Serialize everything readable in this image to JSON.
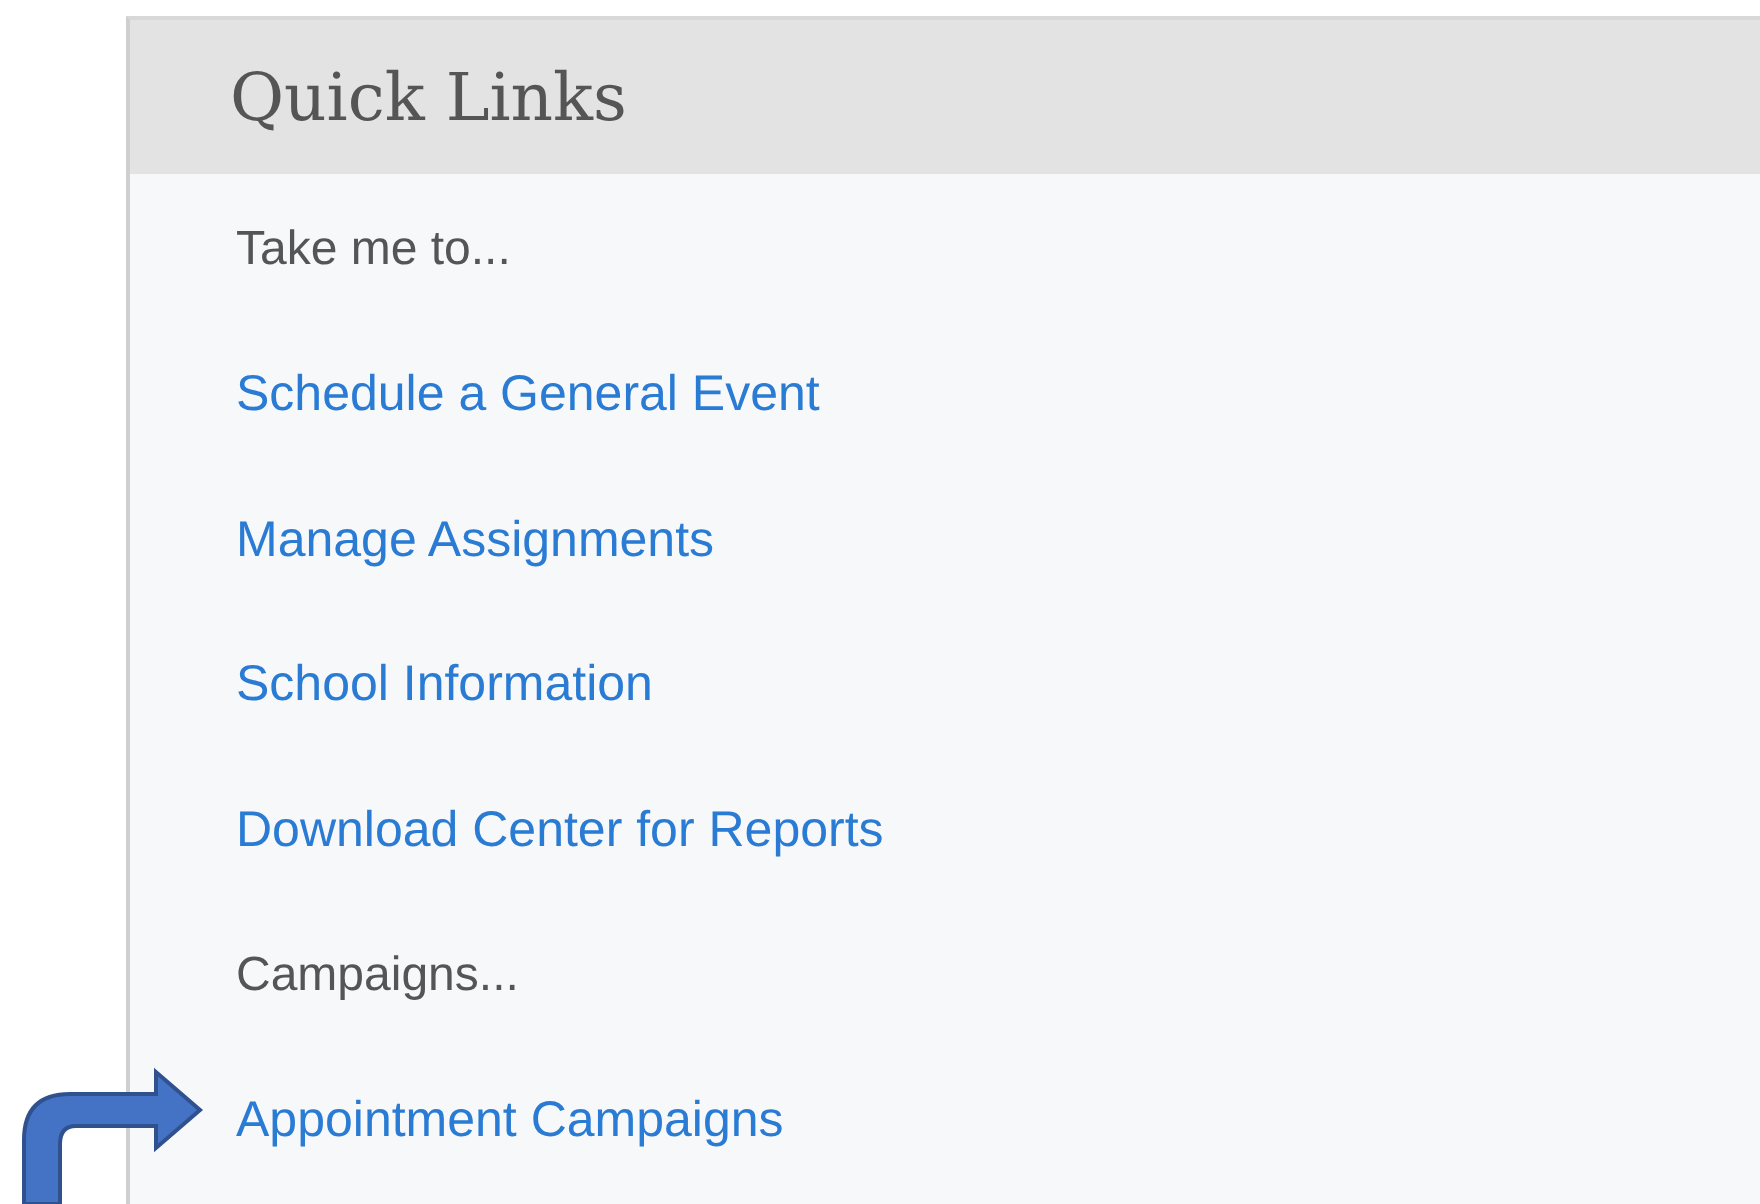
{
  "panel": {
    "title": "Quick Links",
    "items": [
      {
        "kind": "label",
        "text": "Take me to..."
      },
      {
        "kind": "link",
        "text": "Schedule a General Event"
      },
      {
        "kind": "link",
        "text": "Manage Assignments"
      },
      {
        "kind": "link",
        "text": "School Information"
      },
      {
        "kind": "link",
        "text": "Download Center for Reports"
      },
      {
        "kind": "label",
        "text": "Campaigns..."
      },
      {
        "kind": "link",
        "text": "Appointment Campaigns"
      }
    ]
  }
}
